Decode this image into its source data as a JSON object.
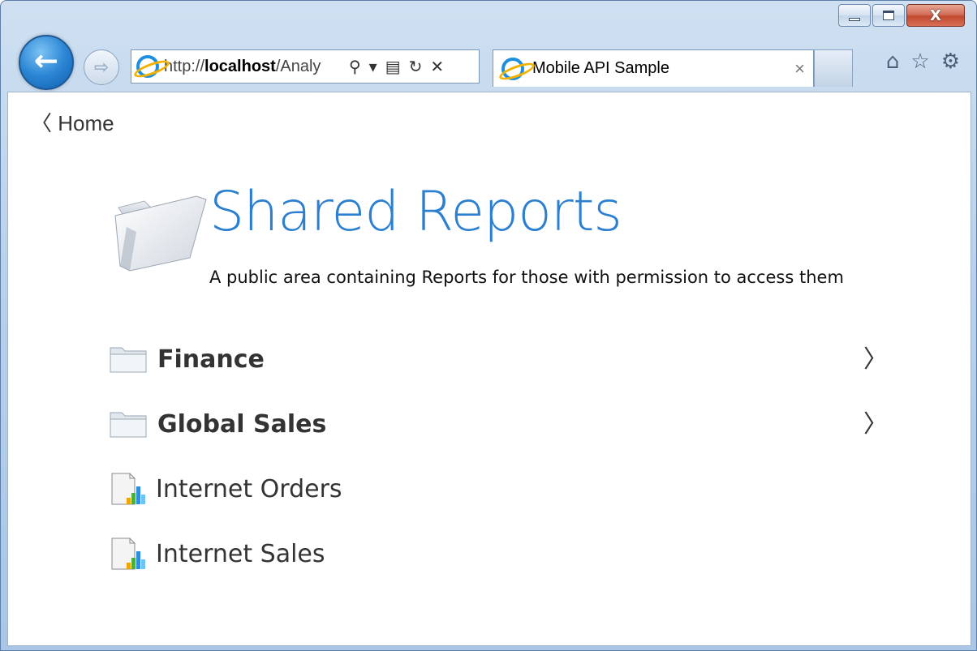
{
  "browser": {
    "address_prefix": "http://",
    "address_host": "localhost",
    "address_rest": "/Analy",
    "tab_title": "Mobile API Sample",
    "tab_close": "×",
    "back_glyph": "←",
    "forward_glyph": "⇨"
  },
  "page": {
    "back_link": "〈 Home",
    "title": "Shared Reports",
    "subtitle": "A public area containing Reports for those with permission to access them"
  },
  "items": [
    {
      "label": "Finance",
      "type": "folder",
      "chevron": "〉"
    },
    {
      "label": "Global Sales",
      "type": "folder",
      "chevron": "〉"
    },
    {
      "label": "Internet Orders",
      "type": "report"
    },
    {
      "label": "Internet Sales",
      "type": "report"
    }
  ],
  "colors": {
    "title_blue": "#2a7fd0",
    "accent": "#1e8fe0"
  }
}
